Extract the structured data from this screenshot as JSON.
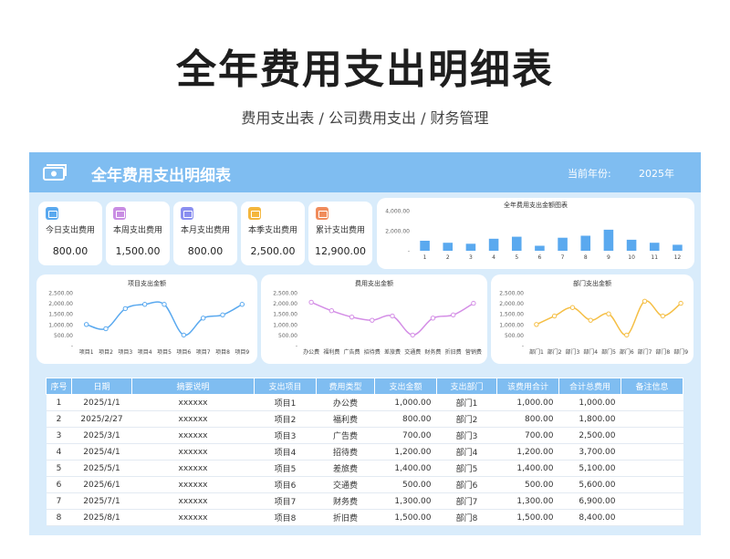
{
  "page": {
    "headline": "全年费用支出明细表",
    "subtitle": "费用支出表 / 公司费用支出 / 财务管理"
  },
  "banner": {
    "title": "全年费用支出明细表",
    "year_label": "当前年份:",
    "year_value": "2025年"
  },
  "stats": [
    {
      "label": "今日支出费用",
      "value": "800.00",
      "color": "#5aa9ef",
      "icon": "wallet-icon"
    },
    {
      "label": "本周支出费用",
      "value": "1,500.00",
      "color": "#c98de3",
      "icon": "wallet-icon"
    },
    {
      "label": "本月支出费用",
      "value": "800.00",
      "color": "#8a8ff0",
      "icon": "wallet-icon"
    },
    {
      "label": "本季支出费用",
      "value": "2,500.00",
      "color": "#f4b63d",
      "icon": "wallet-icon"
    },
    {
      "label": "累计支出费用",
      "value": "12,900.00",
      "color": "#f08c5c",
      "icon": "wallet-icon"
    }
  ],
  "chart_data": [
    {
      "type": "bar",
      "title": "全年费用支出金额图表",
      "categories": [
        "1",
        "2",
        "3",
        "4",
        "5",
        "6",
        "7",
        "8",
        "9",
        "10",
        "11",
        "12"
      ],
      "values": [
        1000,
        800,
        700,
        1200,
        1400,
        500,
        1300,
        1500,
        2100,
        1100,
        800,
        600
      ],
      "y_ticks": [
        "4,000.00",
        "2,000.00",
        "-"
      ],
      "ylim": [
        0,
        4000
      ],
      "color": "#5aa9ef"
    },
    {
      "type": "line",
      "title": "项目支出金额",
      "categories": [
        "项目1",
        "项目2",
        "项目3",
        "项目4",
        "项目5",
        "项目6",
        "项目7",
        "项目8",
        "项目9"
      ],
      "values": [
        1000,
        800,
        1750,
        1950,
        1950,
        500,
        1300,
        1450,
        1950
      ],
      "y_ticks": [
        "2,500.00",
        "2,000.00",
        "1,500.00",
        "1,000.00",
        "500.00",
        "-"
      ],
      "ylim": [
        0,
        2500
      ],
      "color": "#5aa9ef"
    },
    {
      "type": "line",
      "title": "费用支出金额",
      "categories": [
        "办公费",
        "福利费",
        "广告费",
        "招待费",
        "差旅费",
        "交通费",
        "财务费",
        "折旧费",
        "营销费"
      ],
      "values": [
        2050,
        1650,
        1350,
        1200,
        1400,
        500,
        1300,
        1450,
        2000
      ],
      "y_ticks": [
        "2,500.00",
        "2,000.00",
        "1,500.00",
        "1,000.00",
        "500.00",
        "-"
      ],
      "ylim": [
        0,
        2500
      ],
      "color": "#d48ee6"
    },
    {
      "type": "line",
      "title": "部门支出金额",
      "categories": [
        "部门1",
        "部门2",
        "部门3",
        "部门4",
        "部门5",
        "部门6",
        "部门7",
        "部门8",
        "部门9"
      ],
      "values": [
        1000,
        1400,
        1800,
        1200,
        1500,
        500,
        2100,
        1400,
        2000
      ],
      "y_ticks": [
        "2,500.00",
        "2,000.00",
        "1,500.00",
        "1,000.00",
        "500.00",
        "-"
      ],
      "ylim": [
        0,
        2500
      ],
      "color": "#f5bf46"
    }
  ],
  "table": {
    "columns": [
      "序号",
      "日期",
      "摘要说明",
      "支出项目",
      "费用类型",
      "支出金额",
      "支出部门",
      "该费用合计",
      "合计总费用",
      "备注信息"
    ],
    "rows": [
      [
        "1",
        "2025/1/1",
        "xxxxxx",
        "项目1",
        "办公费",
        "1,000.00",
        "部门1",
        "1,000.00",
        "1,000.00",
        ""
      ],
      [
        "2",
        "2025/2/27",
        "xxxxxx",
        "项目2",
        "福利费",
        "800.00",
        "部门2",
        "800.00",
        "1,800.00",
        ""
      ],
      [
        "3",
        "2025/3/1",
        "xxxxxx",
        "项目3",
        "广告费",
        "700.00",
        "部门3",
        "700.00",
        "2,500.00",
        ""
      ],
      [
        "4",
        "2025/4/1",
        "xxxxxx",
        "项目4",
        "招待费",
        "1,200.00",
        "部门4",
        "1,200.00",
        "3,700.00",
        ""
      ],
      [
        "5",
        "2025/5/1",
        "xxxxxx",
        "项目5",
        "差旅费",
        "1,400.00",
        "部门5",
        "1,400.00",
        "5,100.00",
        ""
      ],
      [
        "6",
        "2025/6/1",
        "xxxxxx",
        "项目6",
        "交通费",
        "500.00",
        "部门6",
        "500.00",
        "5,600.00",
        ""
      ],
      [
        "7",
        "2025/7/1",
        "xxxxxx",
        "项目7",
        "财务费",
        "1,300.00",
        "部门7",
        "1,300.00",
        "6,900.00",
        ""
      ],
      [
        "8",
        "2025/8/1",
        "xxxxxx",
        "项目8",
        "折旧费",
        "1,500.00",
        "部门8",
        "1,500.00",
        "8,400.00",
        ""
      ]
    ]
  }
}
